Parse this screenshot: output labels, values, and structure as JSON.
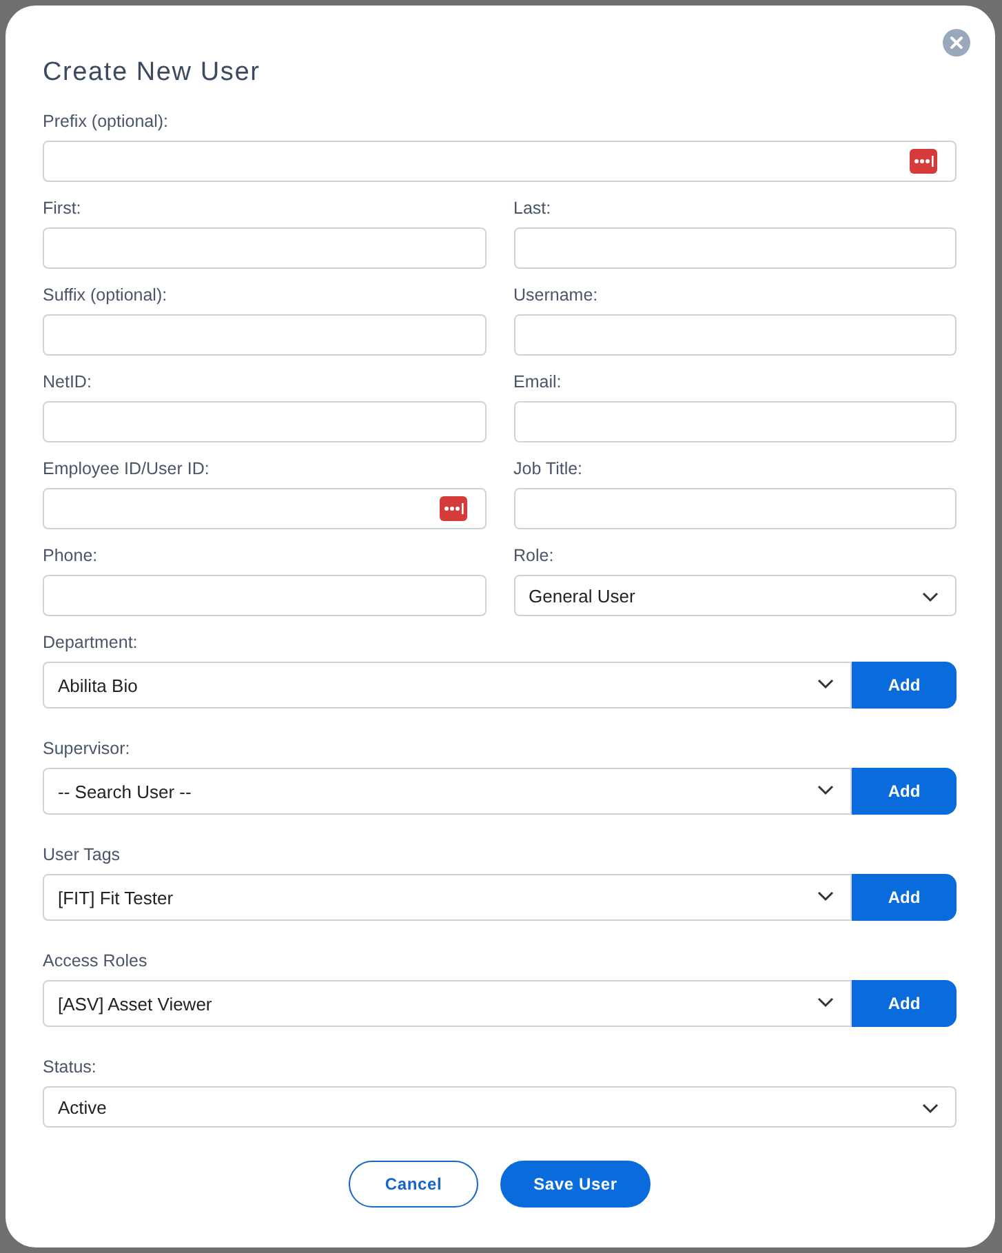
{
  "dialog": {
    "title": "Create New User"
  },
  "rows": [
    [
      {
        "label": "Prefix (optional):",
        "kind": "text",
        "autofill_icon": true
      }
    ],
    [
      {
        "label": "First:",
        "kind": "text",
        "autofill_icon": false
      },
      {
        "label": "Last:",
        "kind": "text",
        "autofill_icon": false
      }
    ],
    [
      {
        "label": "Suffix (optional):",
        "kind": "text",
        "autofill_icon": false
      },
      {
        "label": "Username:",
        "kind": "text",
        "autofill_icon": false
      }
    ],
    [
      {
        "label": "NetID:",
        "kind": "text",
        "autofill_icon": false
      },
      {
        "label": "Email:",
        "kind": "text",
        "autofill_icon": false
      }
    ],
    [
      {
        "label": "Employee ID/User ID:",
        "kind": "text",
        "autofill_icon": true
      },
      {
        "label": "Job Title:",
        "kind": "text",
        "autofill_icon": false
      }
    ],
    [
      {
        "label": "Phone:",
        "kind": "text",
        "autofill_icon": false
      },
      {
        "label": "Role:",
        "kind": "select",
        "value": "General User"
      }
    ],
    [
      {
        "label": "Department:",
        "kind": "select_add",
        "value": "Abilita Bio",
        "button": "Add"
      }
    ],
    [
      {
        "label": "Supervisor:",
        "kind": "select_add",
        "value": "-- Search User --",
        "button": "Add"
      }
    ],
    [
      {
        "label": "User Tags",
        "kind": "select_add",
        "value": "[FIT] Fit Tester",
        "button": "Add"
      }
    ],
    [
      {
        "label": "Access Roles",
        "kind": "select_add",
        "value": "[ASV] Asset Viewer",
        "button": "Add"
      }
    ],
    [
      {
        "label": "Status:",
        "kind": "select",
        "value": "Active"
      }
    ]
  ],
  "buttons": [
    {
      "label": "Cancel",
      "kind": "secondary"
    },
    {
      "label": "Save User",
      "kind": "primary"
    }
  ]
}
